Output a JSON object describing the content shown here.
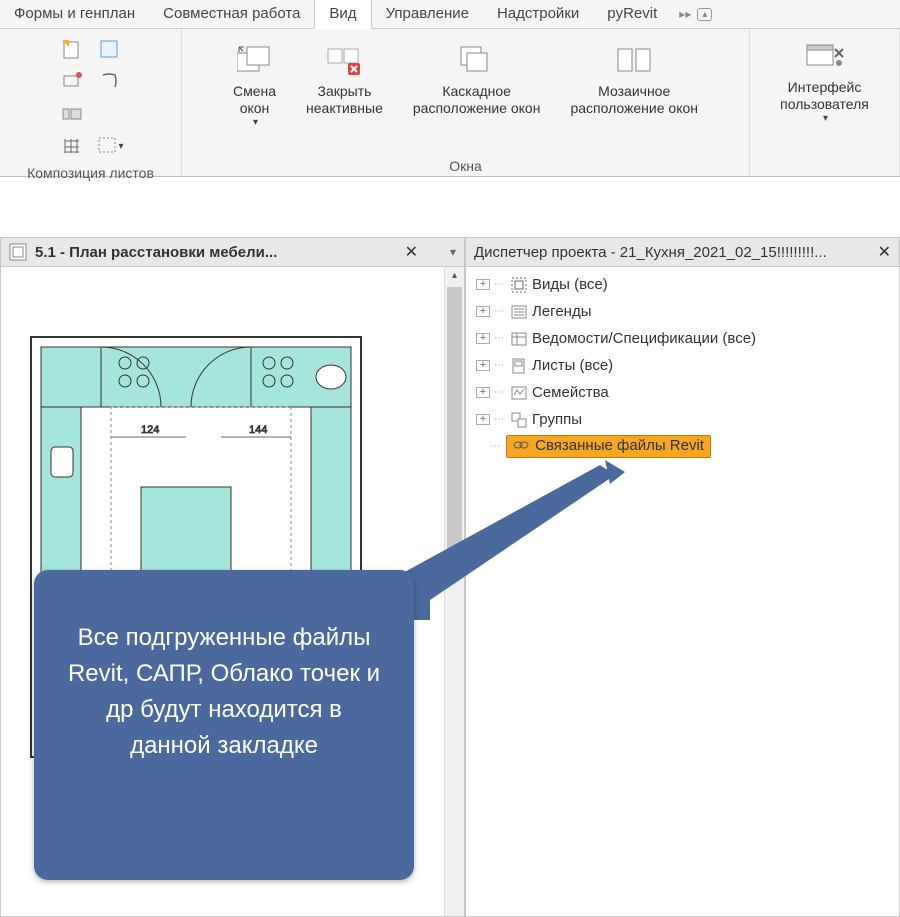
{
  "ribbon": {
    "tabs": [
      "Формы и генплан",
      "Совместная работа",
      "Вид",
      "Управление",
      "Надстройки",
      "pyRevit"
    ],
    "activeTab": "Вид",
    "groups": {
      "composition": "Композиция листов",
      "windows": "Окна"
    },
    "buttons": {
      "switchWindows": "Смена\nокон",
      "closeInactive": "Закрыть\nнеактивные",
      "cascade": "Каскадное\nрасположение окон",
      "tile": "Мозаичное\nрасположение окон",
      "ui": "Интерфейс\nпользователя"
    }
  },
  "viewTab": {
    "title": "5.1 - План расстановки мебели..."
  },
  "browser": {
    "title": "Диспетчер проекта - 21_Кухня_2021_02_15!!!!!!!!!...",
    "items": [
      {
        "label": "Виды (все)"
      },
      {
        "label": "Легенды"
      },
      {
        "label": "Ведомости/Спецификации (все)"
      },
      {
        "label": "Листы (все)"
      },
      {
        "label": "Семейства"
      },
      {
        "label": "Группы"
      },
      {
        "label": "Связанные файлы Revit"
      }
    ]
  },
  "callout": "Все подгруженные файлы Revit, САПР, Облако точек и др будут находится в данной закладке",
  "planDims": {
    "d1": "124",
    "d2": "144"
  }
}
